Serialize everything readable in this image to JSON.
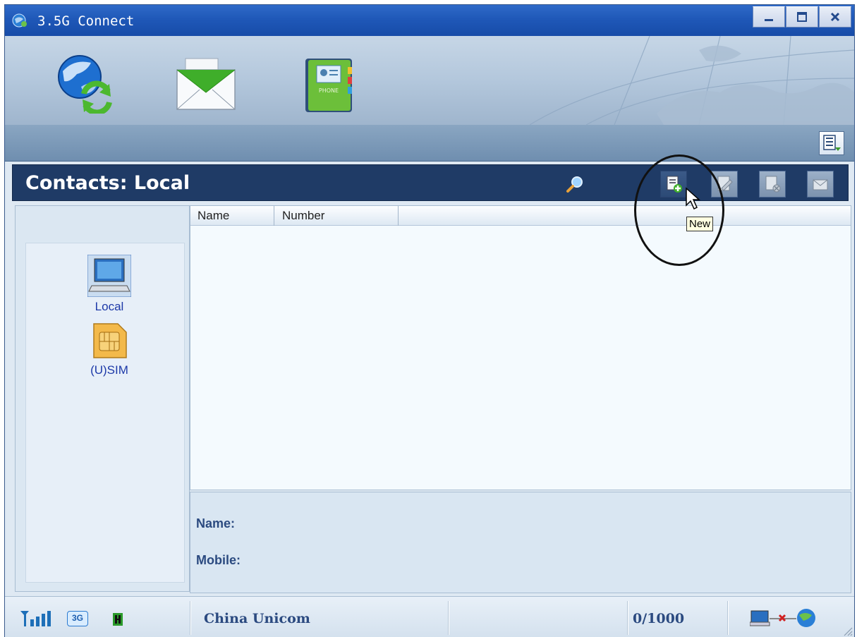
{
  "window": {
    "title": "3.5G Connect"
  },
  "nav": {
    "icons": [
      "internet-connect-icon",
      "sms-envelope-icon",
      "phonebook-icon"
    ],
    "phonebook_label": "PHONE"
  },
  "contacts": {
    "heading": "Contacts: Local"
  },
  "toolbar": {
    "tooltip": "New",
    "tools": [
      "new-contact",
      "edit-contact",
      "delete-contact",
      "send-message"
    ]
  },
  "sources": [
    {
      "label": "Local"
    },
    {
      "label": "(U)SIM"
    }
  ],
  "list": {
    "columns": [
      "Name",
      "Number"
    ]
  },
  "details": {
    "name_label": "Name:",
    "mobile_label": "Mobile:"
  },
  "status": {
    "network": "3G",
    "operator": "China Unicom",
    "capacity": "0/1000"
  },
  "colors": {
    "header_bg": "#1f3b66",
    "title_bar": "#1f58b8",
    "accent_text": "#2b4a80"
  }
}
